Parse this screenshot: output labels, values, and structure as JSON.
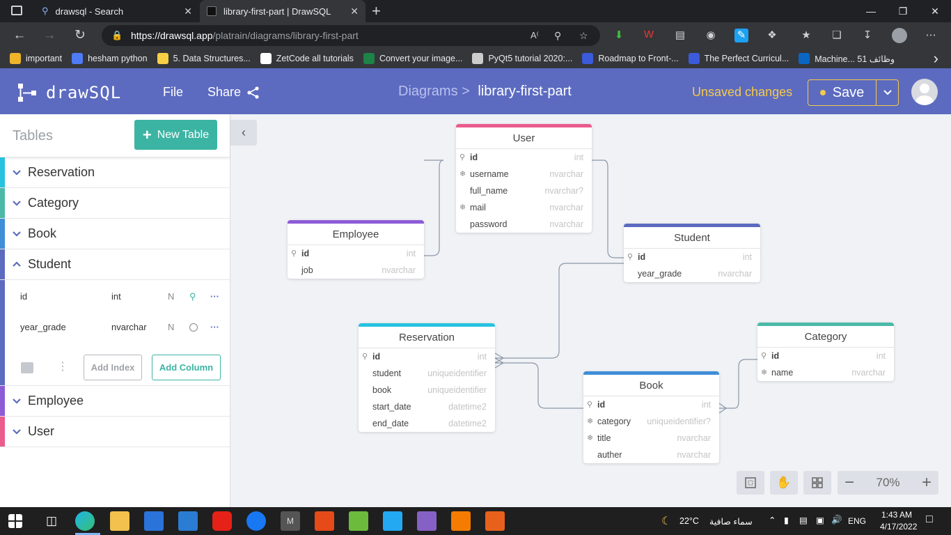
{
  "browser": {
    "tabs": [
      {
        "title": "drawsql - Search",
        "icon": "search-icon"
      },
      {
        "title": "library-first-part | DrawSQL",
        "icon": "drawsql-favicon"
      }
    ],
    "url_host": "https://drawsql.app",
    "url_path": "/platrain/diagrams/library-first-part",
    "bookmarks": [
      {
        "label": "important",
        "icon": "folder-icon",
        "color": "#f0b429"
      },
      {
        "label": "hesham python",
        "icon": "doc-icon",
        "color": "#4f7cf5"
      },
      {
        "label": "5. Data Structures...",
        "icon": "python-icon",
        "color": "#f7d046"
      },
      {
        "label": "ZetCode all tutorials",
        "icon": "square-icon",
        "color": "#ffffff"
      },
      {
        "label": "Convert your image...",
        "icon": "excel-icon",
        "color": "#1d8348"
      },
      {
        "label": "PyQt5 tutorial 2020:...",
        "icon": "page-icon",
        "color": "#cccccc"
      },
      {
        "label": "Roadmap to Front-...",
        "icon": "diamond-icon",
        "color": "#3b5bdb"
      },
      {
        "label": "The Perfect Curricul...",
        "icon": "diamond-icon",
        "color": "#3b5bdb"
      },
      {
        "label": "Machine... وظائف 51",
        "icon": "linkedin-icon",
        "color": "#0a66c2"
      }
    ]
  },
  "app": {
    "brand": "drawSQL",
    "menu_file": "File",
    "menu_share": "Share",
    "crumb_parent": "Diagrams >",
    "crumb_current": "library-first-part",
    "unsaved": "Unsaved changes",
    "save_label": "Save",
    "accent": "#5c6bc0"
  },
  "sidebar": {
    "title": "Tables",
    "new_table": "New Table",
    "items": [
      {
        "name": "Reservation",
        "color": "#27c2e0"
      },
      {
        "name": "Category",
        "color": "#4cb9a8"
      },
      {
        "name": "Book",
        "color": "#3f8ed8"
      },
      {
        "name": "Student",
        "color": "#5c6bc0"
      },
      {
        "name": "Employee",
        "color": "#8d5bd6"
      },
      {
        "name": "User",
        "color": "#ea5c8c"
      }
    ],
    "student_columns": [
      {
        "name": "id",
        "type": "int",
        "nullable": "N"
      },
      {
        "name": "year_grade",
        "type": "nvarchar",
        "nullable": "N"
      }
    ],
    "add_index": "Add Index",
    "add_column": "Add Column"
  },
  "diagram": {
    "tables": [
      {
        "name": "User",
        "color": "#ea5c8c",
        "columns": [
          {
            "name": "id",
            "type": "int",
            "icon": "key"
          },
          {
            "name": "username",
            "type": "nvarchar",
            "icon": "index"
          },
          {
            "name": "full_name",
            "type": "nvarchar?",
            "icon": ""
          },
          {
            "name": "mail",
            "type": "nvarchar",
            "icon": "index"
          },
          {
            "name": "password",
            "type": "nvarchar",
            "icon": ""
          }
        ]
      },
      {
        "name": "Employee",
        "color": "#8d5bd6",
        "columns": [
          {
            "name": "id",
            "type": "int",
            "icon": "key"
          },
          {
            "name": "job",
            "type": "nvarchar",
            "icon": ""
          }
        ]
      },
      {
        "name": "Student",
        "color": "#5c6bc0",
        "columns": [
          {
            "name": "id",
            "type": "int",
            "icon": "key"
          },
          {
            "name": "year_grade",
            "type": "nvarchar",
            "icon": ""
          }
        ]
      },
      {
        "name": "Reservation",
        "color": "#27c2e0",
        "columns": [
          {
            "name": "id",
            "type": "int",
            "icon": "key"
          },
          {
            "name": "student",
            "type": "uniqueidentifier",
            "icon": ""
          },
          {
            "name": "book",
            "type": "uniqueidentifier",
            "icon": ""
          },
          {
            "name": "start_date",
            "type": "datetime2",
            "icon": ""
          },
          {
            "name": "end_date",
            "type": "datetime2",
            "icon": ""
          }
        ]
      },
      {
        "name": "Category",
        "color": "#4cb9a8",
        "columns": [
          {
            "name": "id",
            "type": "int",
            "icon": "key"
          },
          {
            "name": "name",
            "type": "nvarchar",
            "icon": "index"
          }
        ]
      },
      {
        "name": "Book",
        "color": "#3f8ed8",
        "columns": [
          {
            "name": "id",
            "type": "int",
            "icon": "key"
          },
          {
            "name": "category",
            "type": "uniqueidentifier?",
            "icon": "index"
          },
          {
            "name": "title",
            "type": "nvarchar",
            "icon": "index"
          },
          {
            "name": "auther",
            "type": "nvarchar",
            "icon": ""
          }
        ]
      }
    ],
    "zoom": "70%"
  },
  "taskbar": {
    "weather": "22°C",
    "weather_text": "سماء صافية",
    "lang": "ENG",
    "time": "1:43 AM",
    "date": "4/17/2022"
  }
}
